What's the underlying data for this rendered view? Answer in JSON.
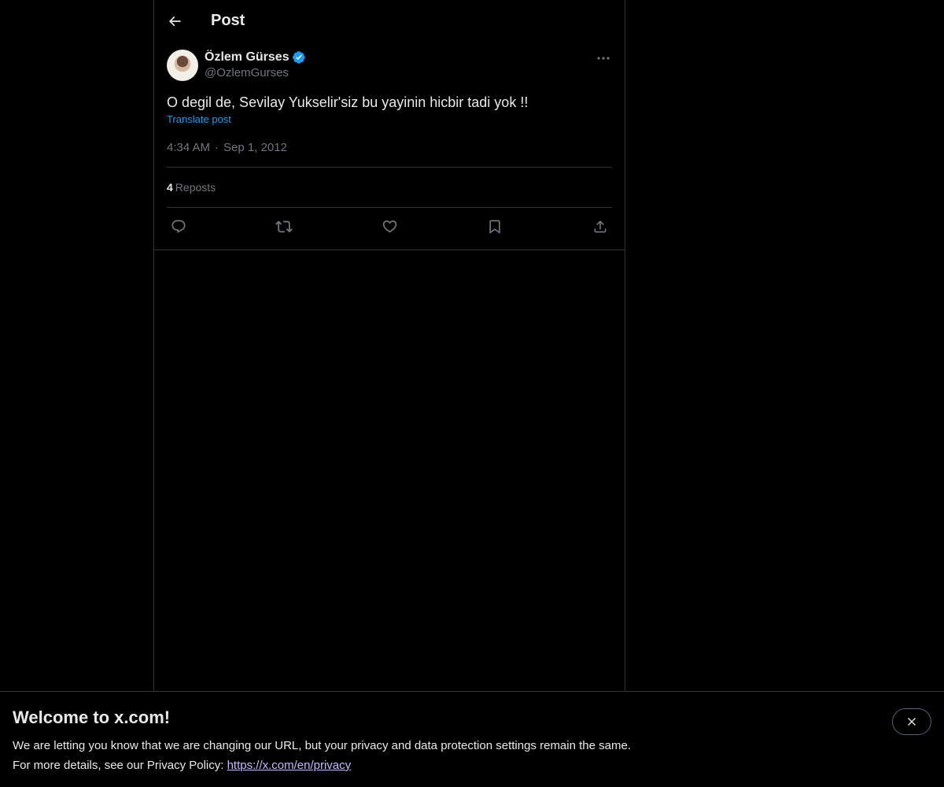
{
  "header": {
    "title": "Post"
  },
  "post": {
    "author": {
      "display_name": "Özlem Gürses",
      "handle": "@OzlemGurses",
      "verified": true
    },
    "text": "O degil de, Sevilay Yukselir'siz bu yayinin hicbir tadi yok !!",
    "translate_label": "Translate post",
    "time": "4:34 AM",
    "separator": "·",
    "date": "Sep 1, 2012",
    "stats": {
      "reposts_count": "4",
      "reposts_label": "Reposts"
    },
    "actions": [
      "reply",
      "repost",
      "like",
      "bookmark",
      "share"
    ]
  },
  "banner": {
    "title": "Welcome to x.com!",
    "line1": "We are letting you know that we are changing our URL, but your privacy and data protection settings remain the same.",
    "line2_prefix": "For more details, see our Privacy Policy: ",
    "link_text": "https://x.com/en/privacy"
  },
  "colors": {
    "background": "#000000",
    "text_primary": "#e7e9ea",
    "text_secondary": "#71767b",
    "accent": "#1d9bf0",
    "border": "#2f3336"
  }
}
